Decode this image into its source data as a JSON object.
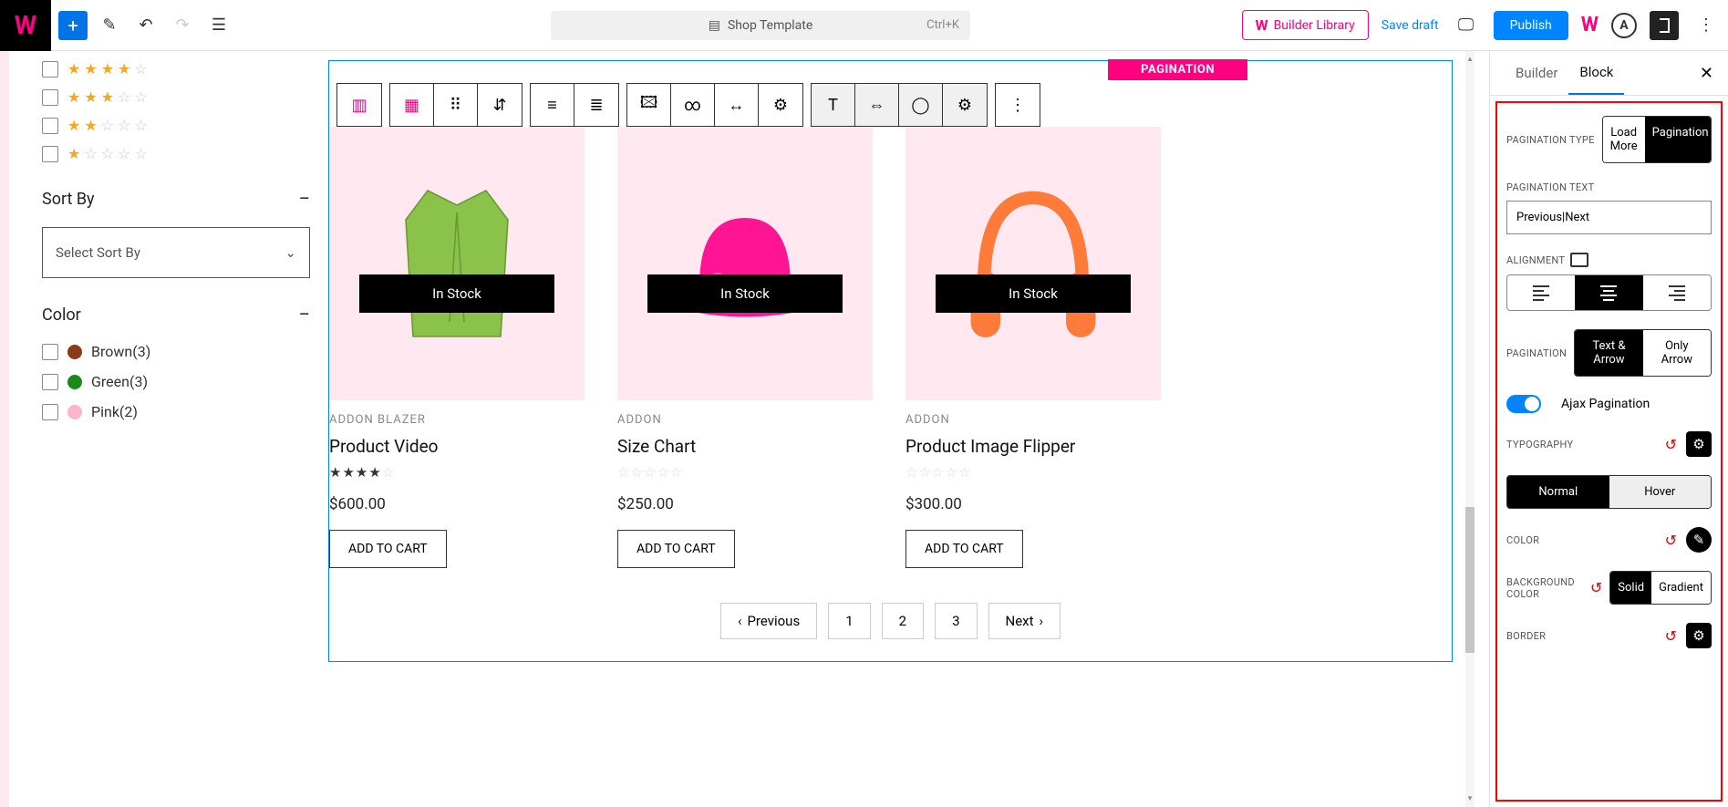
{
  "topbar": {
    "page_title": "Shop Template",
    "shortcut": "Ctrl+K",
    "builder_library": "Builder Library",
    "save_draft": "Save draft",
    "publish": "Publish"
  },
  "sidebar": {
    "sort_by": "Sort By",
    "sort_placeholder": "Select Sort By",
    "color_hdr": "Color",
    "colors": [
      {
        "label": "Brown(3)",
        "hex": "#8b3a1a"
      },
      {
        "label": "Green(3)",
        "hex": "#1a8b1a"
      },
      {
        "label": "Pink(2)",
        "hex": "#ffb3cc"
      }
    ]
  },
  "canvas": {
    "badge": "PAGINATION",
    "instock": "In Stock",
    "atc": "ADD TO CART",
    "products": [
      {
        "cat": "ADDON BLAZER",
        "title": "Product Video",
        "price": "$600.00",
        "rating": 4
      },
      {
        "cat": "ADDON",
        "title": "Size Chart",
        "price": "$250.00",
        "rating": 0
      },
      {
        "cat": "ADDON",
        "title": "Product Image Flipper",
        "price": "$300.00",
        "rating": 0
      }
    ],
    "pagination": {
      "prev": "Previous",
      "next": "Next",
      "pages": [
        "1",
        "2",
        "3"
      ]
    }
  },
  "panel": {
    "tab_builder": "Builder",
    "tab_block": "Block",
    "pag_type_label": "PAGINATION TYPE",
    "load_more": "Load More",
    "pagination": "Pagination",
    "pag_text_label": "PAGINATION TEXT",
    "pag_text_value": "Previous|Next",
    "alignment": "ALIGNMENT",
    "pag_style_label": "PAGINATION",
    "text_arrow": "Text & Arrow",
    "only_arrow": "Only Arrow",
    "ajax": "Ajax Pagination",
    "typography": "TYPOGRAPHY",
    "normal": "Normal",
    "hover": "Hover",
    "color": "COLOR",
    "bg_color": "BACKGROUND COLOR",
    "solid": "Solid",
    "gradient": "Gradient",
    "border": "BORDER"
  }
}
